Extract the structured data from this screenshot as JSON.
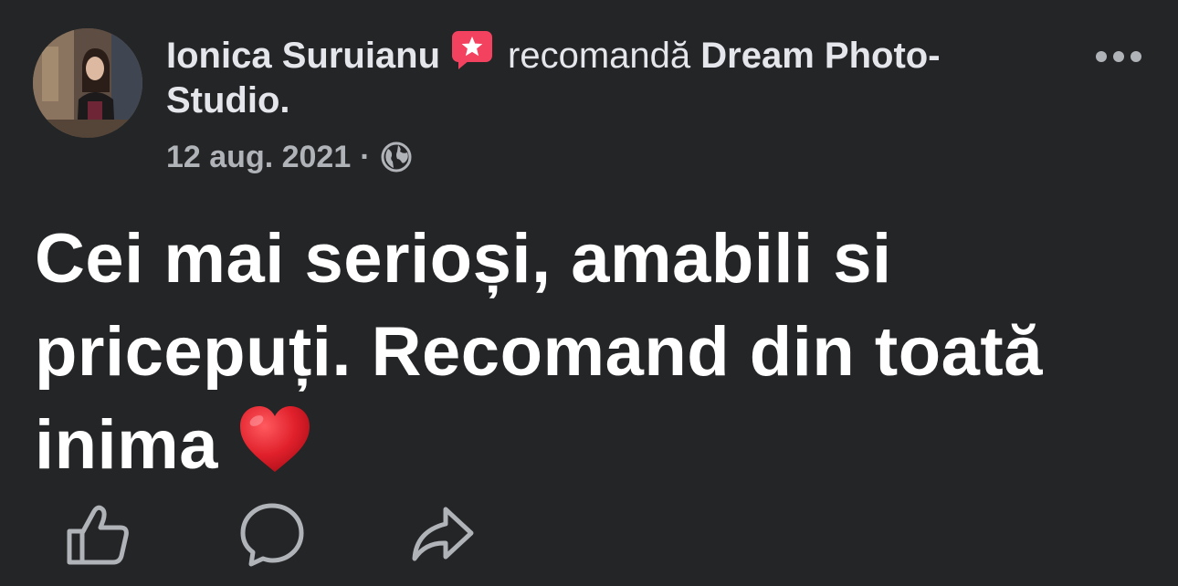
{
  "post": {
    "author_name": "Ionica Suruianu",
    "verb": "recomandă",
    "page_name": "Dream Photo-Studio.",
    "date": "12 aug. 2021",
    "separator": "·",
    "privacy_icon": "globe-icon",
    "recommend_icon": "recommend-star-icon",
    "body": "Cei mai serioși, amabili si pricepuți. Recomand din toată inima",
    "emoji": "red-heart-emoji"
  },
  "actions": {
    "like_icon": "thumbs-up-icon",
    "comment_icon": "comment-bubble-icon",
    "share_icon": "share-arrow-icon"
  },
  "colors": {
    "background": "#242526",
    "primary_text": "#e4e6eb",
    "secondary_text": "#b0b3b8",
    "recommend_badge": "#f3425f",
    "heart": "#e0202b"
  }
}
